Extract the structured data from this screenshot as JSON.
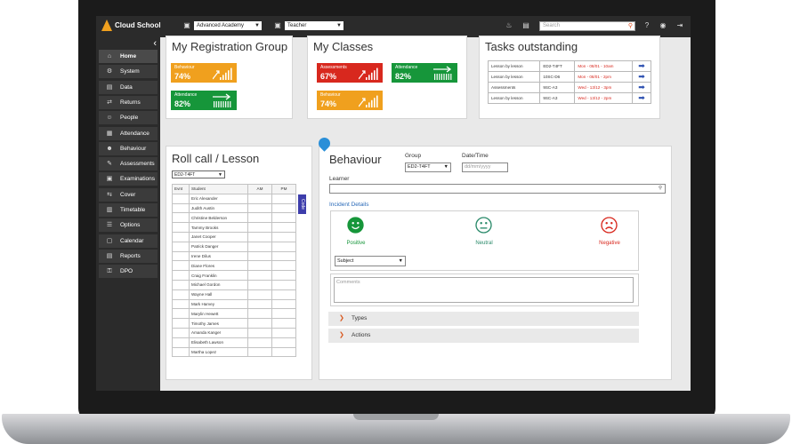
{
  "app": {
    "name": "Cloud School",
    "school": "Advanced Academy",
    "role": "Teacher",
    "search_placeholder": "Search"
  },
  "sidebar": {
    "items": [
      {
        "label": "Home",
        "icon": "home-icon",
        "glyph": "⌂",
        "active": true
      },
      {
        "label": "System",
        "icon": "system-icon",
        "glyph": "⚙"
      },
      {
        "label": "Data",
        "icon": "data-icon",
        "glyph": "▤"
      },
      {
        "label": "Returns",
        "icon": "returns-icon",
        "glyph": "⇄"
      },
      {
        "label": "People",
        "icon": "people-icon",
        "glyph": "☺"
      },
      {
        "label": "Attendance",
        "icon": "attendance-icon",
        "glyph": "▦"
      },
      {
        "label": "Behaviour",
        "icon": "behaviour-icon",
        "glyph": "☻"
      },
      {
        "label": "Assessments",
        "icon": "assessments-icon",
        "glyph": "✎"
      },
      {
        "label": "Examinations",
        "icon": "examinations-icon",
        "glyph": "▣"
      },
      {
        "label": "Cover",
        "icon": "cover-icon",
        "glyph": "⇆"
      },
      {
        "label": "Timetable",
        "icon": "timetable-icon",
        "glyph": "▥"
      },
      {
        "label": "Options",
        "icon": "options-icon",
        "glyph": "☰"
      },
      {
        "label": "Calendar",
        "icon": "calendar-icon",
        "glyph": "▢"
      },
      {
        "label": "Reports",
        "icon": "reports-icon",
        "glyph": "▤"
      },
      {
        "label": "DPO",
        "icon": "dpo-icon",
        "glyph": "⚿"
      }
    ]
  },
  "registration": {
    "title": "My Registration Group",
    "tiles": [
      {
        "label": "Behaviour",
        "value": "74%",
        "color": "#f0a01e",
        "icon": "bars-chart-icon"
      },
      {
        "label": "Attendance",
        "value": "82%",
        "color": "#16963a",
        "icon": "arrow-bars-icon"
      }
    ]
  },
  "classes": {
    "title": "My Classes",
    "tiles": [
      {
        "label": "Assessments",
        "value": "67%",
        "color": "#d8281e",
        "icon": "bars-chart-icon"
      },
      {
        "label": "Attendance",
        "value": "82%",
        "color": "#16963a",
        "icon": "arrow-bars-icon"
      },
      {
        "label": "Behaviour",
        "value": "74%",
        "color": "#f0a01e",
        "icon": "bars-chart-icon"
      }
    ]
  },
  "tasks": {
    "title": "Tasks outstanding",
    "rows": [
      [
        "Lesson by lesson",
        "ED2-T4FT",
        "Mon - 08/01 - 10am"
      ],
      [
        "Lesson by lesson",
        "10SC-D6",
        "Mon - 08/01 - 2pm"
      ],
      [
        "Assessments",
        "9SC-A3",
        "Wed - 13/12 - 3pm"
      ],
      [
        "Lesson by lesson",
        "9SC-A3",
        "Wed - 13/12 - 2pm"
      ]
    ]
  },
  "rollcall": {
    "title": "Roll call / Lesson",
    "group": "ED2-T4FT",
    "headers": [
      "Evnt",
      "Student",
      "AM",
      "PM"
    ],
    "students": [
      "Eric Alexander",
      "Judith Austin",
      "Christine Belderson",
      "Tammy Brooks",
      "Janet Cooper",
      "Patrick Danger",
      "Irene Dilus",
      "Diane Flores",
      "Craig Franklin",
      "Michael Gordon",
      "Wayne Hall",
      "Mark Harvey",
      "Marylin Hewett",
      "Timothy James",
      "Amanda Kanger",
      "Elisabeth Lawson",
      "Martha Lopez"
    ],
    "code_tab": "Code"
  },
  "behaviour": {
    "title": "Behaviour",
    "group_label": "Group",
    "group_value": "ED2-T4FT",
    "date_label": "Date/Time",
    "date_placeholder": "dd/mm/yyyy",
    "learner_label": "Learner",
    "incident_label": "Incident Details",
    "faces": [
      {
        "label": "Positive",
        "color": "#16963a"
      },
      {
        "label": "Neutral",
        "color": "#2a8a6a"
      },
      {
        "label": "Negative",
        "color": "#d8281e"
      }
    ],
    "subject_value": "Subject",
    "comments_placeholder": "Comments",
    "accordions": [
      "Types",
      "Actions"
    ]
  }
}
